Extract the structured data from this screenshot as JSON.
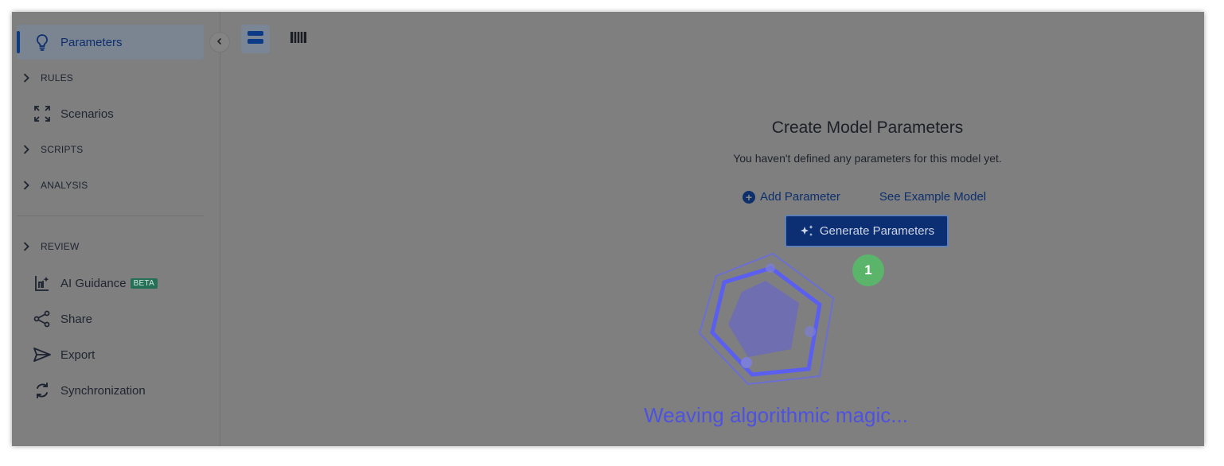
{
  "sidebar": {
    "parameters": "Parameters",
    "rules": "RULES",
    "scenarios": "Scenarios",
    "scripts": "SCRIPTS",
    "analysis": "ANALYSIS",
    "review": "REVIEW",
    "ai_guidance": "AI Guidance",
    "ai_badge": "BETA",
    "share": "Share",
    "export": "Export",
    "synchronization": "Synchronization"
  },
  "main": {
    "title": "Create Model Parameters",
    "subtitle": "You haven't defined any parameters for this model yet.",
    "add_parameter": "Add Parameter",
    "see_example": "See Example Model",
    "generate": "Generate Parameters",
    "step_number": "1",
    "loading_text": "Weaving algorithmic magic..."
  },
  "colors": {
    "accent": "#0c2f73",
    "loader": "#5b5ff0",
    "step_badge": "#5ab56b"
  }
}
